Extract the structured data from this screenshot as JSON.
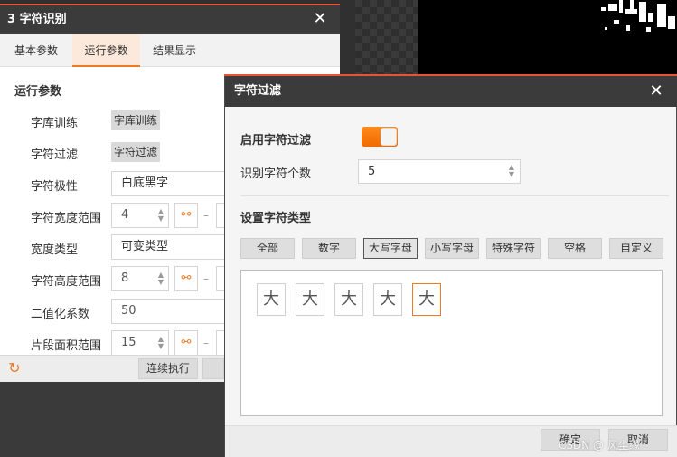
{
  "left_panel": {
    "title": "3 字符识别",
    "close_glyph": "✕",
    "tabs": [
      {
        "label": "基本参数"
      },
      {
        "label": "运行参数"
      },
      {
        "label": "结果显示"
      }
    ],
    "section_title": "运行参数",
    "rows": {
      "lib_train": {
        "label": "字库训练",
        "chip": "字库训练"
      },
      "char_filter": {
        "label": "字符过滤",
        "chip": "字符过滤"
      },
      "polarity": {
        "label": "字符极性",
        "value": "白底黑字"
      },
      "width_range": {
        "label": "字符宽度范围",
        "value": "4"
      },
      "width_type": {
        "label": "宽度类型",
        "value": "可变类型"
      },
      "height_range": {
        "label": "字符高度范围",
        "value": "8"
      },
      "binarize": {
        "label": "二值化系数",
        "value": "50"
      },
      "segment_area": {
        "label": "片段面积范围",
        "value": "15"
      }
    },
    "range_dash": "–",
    "link_icon": "link-icon",
    "footer": {
      "run_label": "连续执行",
      "refresh_icon": "refresh-icon"
    }
  },
  "dialog": {
    "title": "字符过滤",
    "close_glyph": "✕",
    "enable_label": "启用字符过滤",
    "enable_on": true,
    "count_label": "识别字符个数",
    "count_value": "5",
    "type_section": "设置字符类型",
    "type_buttons": [
      {
        "label": "全部"
      },
      {
        "label": "数字"
      },
      {
        "label": "大写字母"
      },
      {
        "label": "小写字母"
      },
      {
        "label": "特殊字符"
      },
      {
        "label": "空格"
      },
      {
        "label": "自定义"
      }
    ],
    "active_type_index": 2,
    "chars": [
      "大",
      "大",
      "大",
      "大",
      "大"
    ],
    "selected_char_index": 4,
    "ok_label": "确定",
    "cancel_label": "取消"
  },
  "watermark": "CSDN @ 风尘缘",
  "colors": {
    "accent": "#f07a22",
    "title_bar": "#3b3b3b",
    "top_line": "#e8533a"
  }
}
